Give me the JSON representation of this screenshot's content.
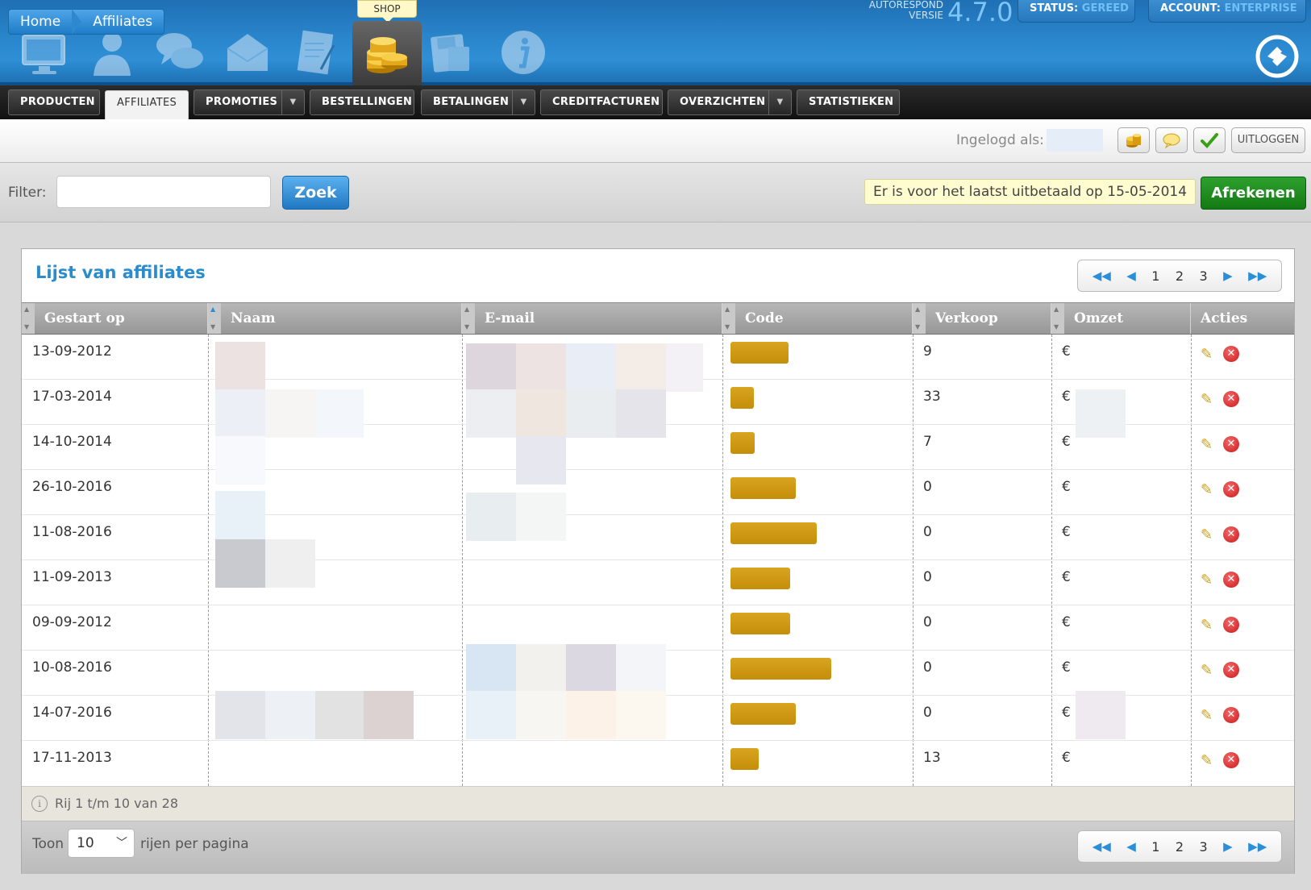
{
  "header": {
    "shop_tooltip": "SHOP",
    "version_label_1": "AUTORESPOND",
    "version_label_2": "VERSIE",
    "version_number": "4.7.0",
    "status_label": "STATUS:",
    "status_value": "GEREED",
    "account_label": "ACCOUNT:",
    "account_value": "ENTERPRISE",
    "icons": [
      "monitor-icon",
      "user-icon",
      "chat-icon",
      "envelope-icon",
      "document-icon",
      "coins-icon",
      "floppy-icon",
      "info-icon"
    ]
  },
  "nav": {
    "items": [
      {
        "label": "PRODUCTEN"
      },
      {
        "label": "AFFILIATES"
      },
      {
        "label": "PROMOTIES"
      },
      {
        "label": "BESTELLINGEN"
      },
      {
        "label": "BETALINGEN"
      },
      {
        "label": "CREDITFACTUREN"
      },
      {
        "label": "OVERZICHTEN"
      },
      {
        "label": "STATISTIEKEN"
      }
    ],
    "active": "AFFILIATES"
  },
  "breadcrumb": {
    "home": "Home",
    "current": "Affiliates"
  },
  "user": {
    "logged_in_label": "Ingelogd als:",
    "logout_label": "UITLOGGEN"
  },
  "filter": {
    "label": "Filter:",
    "value": "",
    "search_label": "Zoek"
  },
  "notice": "Er is voor het laatst uitbetaald op 15-05-2014",
  "checkout_label": "Afrekenen",
  "panel": {
    "title": "Lijst van affiliates"
  },
  "pagination": {
    "pages": [
      "1",
      "2",
      "3"
    ]
  },
  "table": {
    "columns": [
      "Gestart op",
      "Naam",
      "E-mail",
      "Code",
      "Verkoop",
      "Omzet",
      "Acties"
    ],
    "rows": [
      {
        "date": "13-09-2012",
        "sales": "9",
        "currency": "€"
      },
      {
        "date": "17-03-2014",
        "sales": "33",
        "currency": "€"
      },
      {
        "date": "14-10-2014",
        "sales": "7",
        "currency": "€"
      },
      {
        "date": "26-10-2016",
        "sales": "0",
        "currency": "€"
      },
      {
        "date": "11-08-2016",
        "sales": "0",
        "currency": "€"
      },
      {
        "date": "11-09-2013",
        "sales": "0",
        "currency": "€"
      },
      {
        "date": "09-09-2012",
        "sales": "0",
        "currency": "€"
      },
      {
        "date": "10-08-2016",
        "sales": "0",
        "currency": "€"
      },
      {
        "date": "14-07-2016",
        "sales": "0",
        "currency": "€"
      },
      {
        "date": "17-11-2013",
        "sales": "13",
        "currency": "€"
      }
    ]
  },
  "footer": {
    "summary": "Rij 1 t/m 10 van 28",
    "show_label": "Toon",
    "rows_per_page_value": "10",
    "rows_per_page_label": "rijen per pagina"
  }
}
